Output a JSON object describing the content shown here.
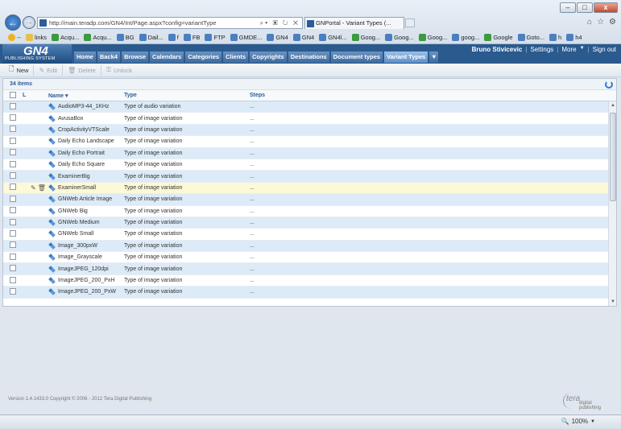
{
  "browser": {
    "url": "http://main.teradp.com/GN4/Int/Page.aspx?config=variantType",
    "tab_title": "GNPortal - Variant Types (...",
    "window_buttons": [
      "–",
      "□",
      "x"
    ],
    "favorites": [
      {
        "label": "--",
        "icon": "star-icon"
      },
      {
        "label": "links",
        "icon": "folder-icon"
      },
      {
        "label": "Acqu...",
        "icon": "google-icon"
      },
      {
        "label": "Acqu...",
        "icon": "google-icon"
      },
      {
        "label": "BG",
        "icon": "page-icon"
      },
      {
        "label": "Dail...",
        "icon": "page-icon"
      },
      {
        "label": "f",
        "icon": "page-icon"
      },
      {
        "label": "FB",
        "icon": "page-icon"
      },
      {
        "label": "FTP",
        "icon": "page-icon"
      },
      {
        "label": "GMDE...",
        "icon": "page-icon"
      },
      {
        "label": "GN4",
        "icon": "page-icon"
      },
      {
        "label": "GN4",
        "icon": "page-icon"
      },
      {
        "label": "GN4l...",
        "icon": "page-icon"
      },
      {
        "label": "Goog...",
        "icon": "google-icon"
      },
      {
        "label": "Goog...",
        "icon": "page-icon"
      },
      {
        "label": "Goog...",
        "icon": "google-icon"
      },
      {
        "label": "goog...",
        "icon": "page-icon"
      },
      {
        "label": "Google",
        "icon": "google-icon"
      },
      {
        "label": "Goto...",
        "icon": "page-icon"
      },
      {
        "label": "h",
        "icon": "page-icon"
      },
      {
        "label": "h4",
        "icon": "page-icon"
      }
    ]
  },
  "app": {
    "logo_big": "GN4",
    "logo_small": "PUBLISHING SYSTEM",
    "nav": [
      "Home",
      "Back4",
      "Browse",
      "Calendars",
      "Categories",
      "Clients",
      "Copyrights",
      "Destinations",
      "Document types",
      "Variant Types"
    ],
    "nav_more": "▼",
    "user": "Bruno Stivicevic",
    "links": [
      "Settings",
      "More",
      "Sign out"
    ],
    "more_arrow": "▼"
  },
  "toolbar": {
    "new": "New",
    "edit": "Edit",
    "delete": "Delete",
    "unlock": "Unlock"
  },
  "list": {
    "count": "34 items",
    "headers": {
      "l": "L",
      "name": "Name",
      "name_sort": "▾",
      "type": "Type",
      "steps": "Steps"
    },
    "rows": [
      {
        "name": "AudioMP3-44_1KHz",
        "type": "Type of audio variation",
        "steps": "..."
      },
      {
        "name": "AvusaBox",
        "type": "Type of image variation",
        "steps": "..."
      },
      {
        "name": "CropActivityVTScale",
        "type": "Type of image variation",
        "steps": "..."
      },
      {
        "name": "Daily Echo Landscape",
        "type": "Type of image variation",
        "steps": "..."
      },
      {
        "name": "Daily Echo Portrait",
        "type": "Type of image variation",
        "steps": "..."
      },
      {
        "name": "Daily Echo Square",
        "type": "Type of image variation",
        "steps": "..."
      },
      {
        "name": "ExaminerBig",
        "type": "Type of image variation",
        "steps": "..."
      },
      {
        "name": "ExaminerSmall",
        "type": "Type of image variation",
        "steps": "...",
        "highlight": true
      },
      {
        "name": "GNWeb Article Image",
        "type": "Type of image variation",
        "steps": "..."
      },
      {
        "name": "GNWeb Big",
        "type": "Type of image variation",
        "steps": "..."
      },
      {
        "name": "GNWeb Medium",
        "type": "Type of image variation",
        "steps": "..."
      },
      {
        "name": "GNWeb Small",
        "type": "Type of image variation",
        "steps": "..."
      },
      {
        "name": "Image_300pxW",
        "type": "Type of image variation",
        "steps": "..."
      },
      {
        "name": "Image_Grayscale",
        "type": "Type of image variation",
        "steps": "..."
      },
      {
        "name": "ImageJPEG_120dpi",
        "type": "Type of image variation",
        "steps": "..."
      },
      {
        "name": "ImageJPEG_200_PxH",
        "type": "Type of image variation",
        "steps": "..."
      },
      {
        "name": "ImageJPEG_200_PxW",
        "type": "Type of image variation",
        "steps": "..."
      }
    ]
  },
  "footer": {
    "version": "Version 1.4.1433.0 Copyright © 2006 - 2012 Tera Digital Publishing",
    "brand": "tera",
    "brand_sub": "digital publishing",
    "zoom": "100%"
  },
  "colors": {
    "header_blue": "#2a5a8e",
    "row_alt": "#dcebf7",
    "row_highlight": "#fdf8d6",
    "link_blue": "#2b5d9a"
  }
}
